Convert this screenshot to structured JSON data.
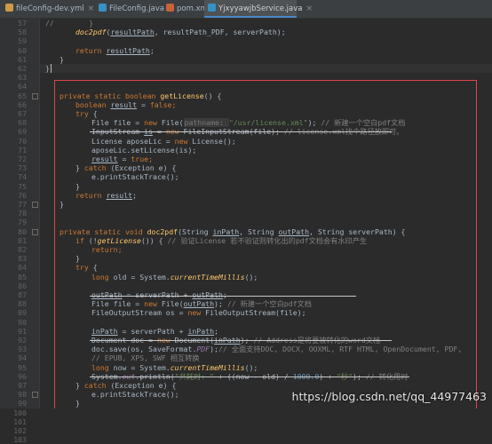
{
  "tabs": [
    {
      "label": "fileConfig-dev.yml",
      "icon_color": "#cb9a4a",
      "active": false
    },
    {
      "label": "FileConfig.java",
      "icon_color": "#3592c4",
      "active": false
    },
    {
      "label": "pom.xml",
      "icon_color": "#c9623a",
      "active": false
    },
    {
      "label": "YjxyyawjbService.java",
      "icon_color": "#3592c4",
      "active": true
    }
  ],
  "tab_close_glyph": "×",
  "line_numbers": [
    "57",
    "58",
    "59",
    "60",
    "61",
    "62",
    "63",
    "64",
    "65",
    "66",
    "67",
    "68",
    "69",
    "70",
    "71",
    "72",
    "73",
    "74",
    "75",
    "76",
    "77",
    "78",
    "79",
    "80",
    "81",
    "82",
    "83",
    "84",
    "85",
    "86",
    "87",
    "88",
    "89",
    "90",
    "91",
    "92",
    "93",
    "94",
    "95",
    "96",
    "97",
    "98",
    "99",
    "100",
    "101",
    "102",
    "103"
  ],
  "code": {
    "l57": "//        }",
    "l58_a": "doc2pdf",
    "l58_b": "(",
    "l58_c": "resultPath",
    "l58_d": ", resultPath_PDF, serverPath);",
    "l60_a": "return ",
    "l60_b": "resultPath",
    "l60_c": ";",
    "l61": "}",
    "l62": "}",
    "l65_kw": "private static boolean ",
    "l65_fn": "getLicense",
    "l65_rest": "() {",
    "l66_kw": "boolean ",
    "l66_var": "result",
    "l66_eq": " = ",
    "l66_val": "false",
    "l66_end": ";",
    "l67_kw": "try",
    "l67_rest": " {",
    "l68_a": "File file = ",
    "l68_new": "new ",
    "l68_b": "File(",
    "l68_hint": "pathname: ",
    "l68_str": "\"/usr/license.xml\"",
    "l68_c": "); ",
    "l68_cm": "// 新建一个空白pdf文档",
    "l69_a": "InputStream ",
    "l69_var": "is",
    "l69_eq": " = ",
    "l69_new": "new ",
    "l69_b": "FileInputStream(file); ",
    "l69_cm": "// license.xml找个路径放即可。",
    "l70_a": "License aposeLic = ",
    "l70_new": "new ",
    "l70_b": "License();",
    "l71": "aposeLic.setLicense(is);",
    "l72_a": "result",
    "l72_b": " = ",
    "l72_c": "true",
    "l72_d": ";",
    "l73_a": "} ",
    "l73_kw": "catch",
    "l73_b": " (Exception e) {",
    "l74": "e.printStackTrace();",
    "l75": "}",
    "l76_kw": "return ",
    "l76_var": "result",
    "l76_end": ";",
    "l77": "}",
    "l80_kw": "private static void ",
    "l80_fn": "doc2pdf",
    "l80_a": "(String ",
    "l80_p1": "inPath",
    "l80_b": ", String ",
    "l80_p2": "outPath",
    "l80_c": ", String serverPath) {",
    "l81_kw": "if",
    "l81_a": " (!",
    "l81_fn": "getLicense",
    "l81_b": "()) { ",
    "l81_cm": "// 验证License 若不验证则转化出的pdf文档会有水印产生",
    "l82_kw": "return",
    "l82_end": ";",
    "l83": "}",
    "l84_kw": "try",
    "l84_rest": " {",
    "l85_kw": "long ",
    "l85_a": "old = System.",
    "l85_it": "currentTimeMillis",
    "l85_b": "();",
    "l87_a": "outPath",
    "l87_b": " = serverPath + ",
    "l87_c": "outPath",
    "l87_d": ";",
    "l88_a": "File file = ",
    "l88_new": "new ",
    "l88_b": "File(",
    "l88_c": "outPath",
    "l88_d": "); ",
    "l88_cm": "// 新建一个空白pdf文档",
    "l89_a": "FileOutputStream os = ",
    "l89_new": "new ",
    "l89_b": "FileOutputStream(file);",
    "l91_a": "inPath",
    "l91_b": " = serverPath + ",
    "l91_c": "inPath",
    "l91_d": ";",
    "l92_a": "Document doc = ",
    "l92_new": "new ",
    "l92_b": "Document(",
    "l92_c": "inPath",
    "l92_d": "); ",
    "l92_cm": "// Address是将要被转化的word文档",
    "l93_a": "doc.save(os, SaveFormat.",
    "l93_it": "PDF",
    "l93_b": ");",
    "l93_cm": "// 全面支持DOC, DOCX, OOXML, RTF HTML, OpenDocument, PDF,",
    "l94_cm": "// EPUB, XPS, SWF 相互转换",
    "l95_kw": "long ",
    "l95_a": "now = System.",
    "l95_it": "currentTimeMillis",
    "l95_b": "();",
    "l96_a": "System.",
    "l96_out": "out",
    "l96_b": ".println(",
    "l96_s1": "\"共耗时: \"",
    "l96_c": " + ((now - old) / ",
    "l96_n": "1000.0",
    "l96_d": ") + ",
    "l96_s2": "\"秒\"",
    "l96_e": "); ",
    "l96_cm": "// 转化用时",
    "l97_a": "} ",
    "l97_kw": "catch",
    "l97_b": " (Exception e) {",
    "l98": "e.printStackTrace();",
    "l99": "}",
    "l100": "}"
  },
  "watermark": "https://blog.csdn.net/qq_44977463"
}
